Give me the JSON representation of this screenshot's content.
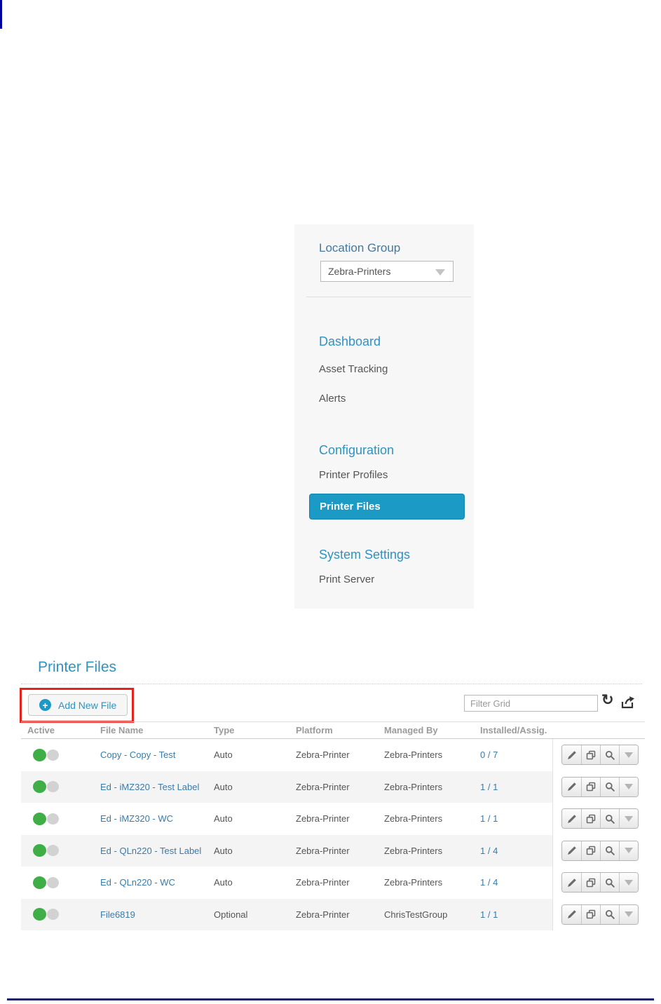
{
  "page": {
    "title": "Printer Files"
  },
  "sidebar": {
    "location_group_label": "Location Group",
    "location_group_value": "Zebra-Printers",
    "sections": [
      {
        "heading": "Dashboard",
        "items": [
          "Asset Tracking",
          "Alerts"
        ]
      },
      {
        "heading": "Configuration",
        "items": [
          "Printer Profiles",
          "Printer Files"
        ]
      },
      {
        "heading": "System Settings",
        "items": [
          "Print Server"
        ]
      }
    ],
    "active_item": "Printer Files"
  },
  "toolbar": {
    "add_button_label": "Add New File",
    "plus_glyph": "+",
    "filter_placeholder": "Filter Grid",
    "refresh_glyph": "↻",
    "icons": [
      "plus-circle-icon",
      "refresh-icon",
      "export-icon"
    ]
  },
  "table": {
    "columns": [
      "Active",
      "File Name",
      "Type",
      "Platform",
      "Managed By",
      "Installed/Assig."
    ],
    "rows": [
      {
        "file_name": "Copy - Copy - Test",
        "type": "Auto",
        "platform": "Zebra-Printer",
        "managed_by": "Zebra-Printers",
        "installed": "0 / 7"
      },
      {
        "file_name": "Ed - iMZ320 - Test Label",
        "type": "Auto",
        "platform": "Zebra-Printer",
        "managed_by": "Zebra-Printers",
        "installed": "1 / 1"
      },
      {
        "file_name": "Ed - iMZ320 - WC",
        "type": "Auto",
        "platform": "Zebra-Printer",
        "managed_by": "Zebra-Printers",
        "installed": "1 / 1"
      },
      {
        "file_name": "Ed - QLn220 - Test Label",
        "type": "Auto",
        "platform": "Zebra-Printer",
        "managed_by": "Zebra-Printers",
        "installed": "1 / 4"
      },
      {
        "file_name": "Ed - QLn220 - WC",
        "type": "Auto",
        "platform": "Zebra-Printer",
        "managed_by": "Zebra-Printers",
        "installed": "1 / 4"
      },
      {
        "file_name": "File6819",
        "type": "Optional",
        "platform": "Zebra-Printer",
        "managed_by": "ChrisTestGroup",
        "installed": "1 / 1"
      }
    ],
    "action_icons": [
      "pencil-icon",
      "copy-icon",
      "magnifier-icon",
      "chevron-down-icon"
    ]
  },
  "colors": {
    "accent_blue": "#2e93c1",
    "selected_item_bg": "#1b9ac6",
    "link_blue": "#3b7ba6",
    "active_green": "#3fae46",
    "inactive_gray": "#d2d2d2",
    "callout_red": "#e3231c",
    "page_rule_navy": "#1b1f66",
    "sidebar_bg": "#f7f7f7"
  }
}
